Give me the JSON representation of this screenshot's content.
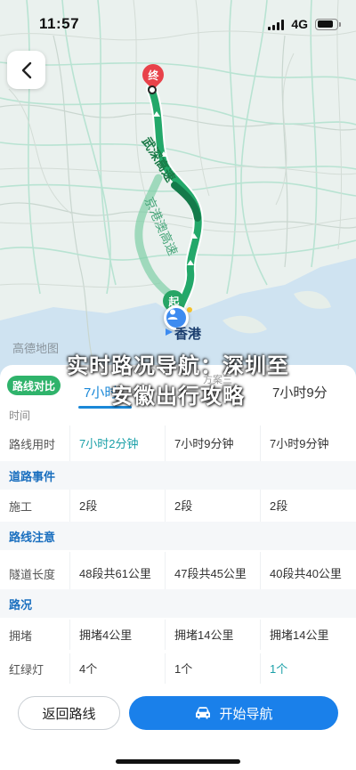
{
  "status_bar": {
    "time": "11:57",
    "network": "4G"
  },
  "colors": {
    "accent_blue": "#1a80ea",
    "route_green": "#2fb36b",
    "highlight_teal": "#1aa0a8"
  },
  "map": {
    "brand": "高德地图",
    "start_marker": "起",
    "end_marker": "终",
    "origin_label": "香港",
    "road_main": "武深高速",
    "road_alt": "京港澳高速"
  },
  "headline": {
    "line1": "实时路况导航：深圳至",
    "line2": "安徽出行攻略"
  },
  "compare": {
    "chip_label": "路线对比",
    "tabs": [
      {
        "label": "7小时"
      },
      {
        "label": "方案三"
      },
      {
        "label": "7小时9分"
      }
    ],
    "section_time": "时间",
    "rows": {
      "duration": {
        "label": "路线用时",
        "values": [
          "7小时2分钟",
          "7小时9分钟",
          "7小时9分钟"
        ]
      }
    },
    "section_events": "道路事件",
    "construction": {
      "label": "施工",
      "values": [
        "2段",
        "2段",
        "2段"
      ]
    },
    "section_notes": "路线注意",
    "tunnels": {
      "label": "隧道长度",
      "values": [
        "48段共61公里",
        "47段共45公里",
        "40段共40公里"
      ]
    },
    "section_traffic": "路况",
    "congestion": {
      "label": "拥堵",
      "values": [
        "拥堵4公里",
        "拥堵14公里",
        "拥堵14公里"
      ]
    },
    "lights": {
      "label": "红绿灯",
      "values": [
        "4个",
        "1个",
        "1个"
      ]
    }
  },
  "actions": {
    "return_label": "返回路线",
    "start_label": "开始导航"
  }
}
